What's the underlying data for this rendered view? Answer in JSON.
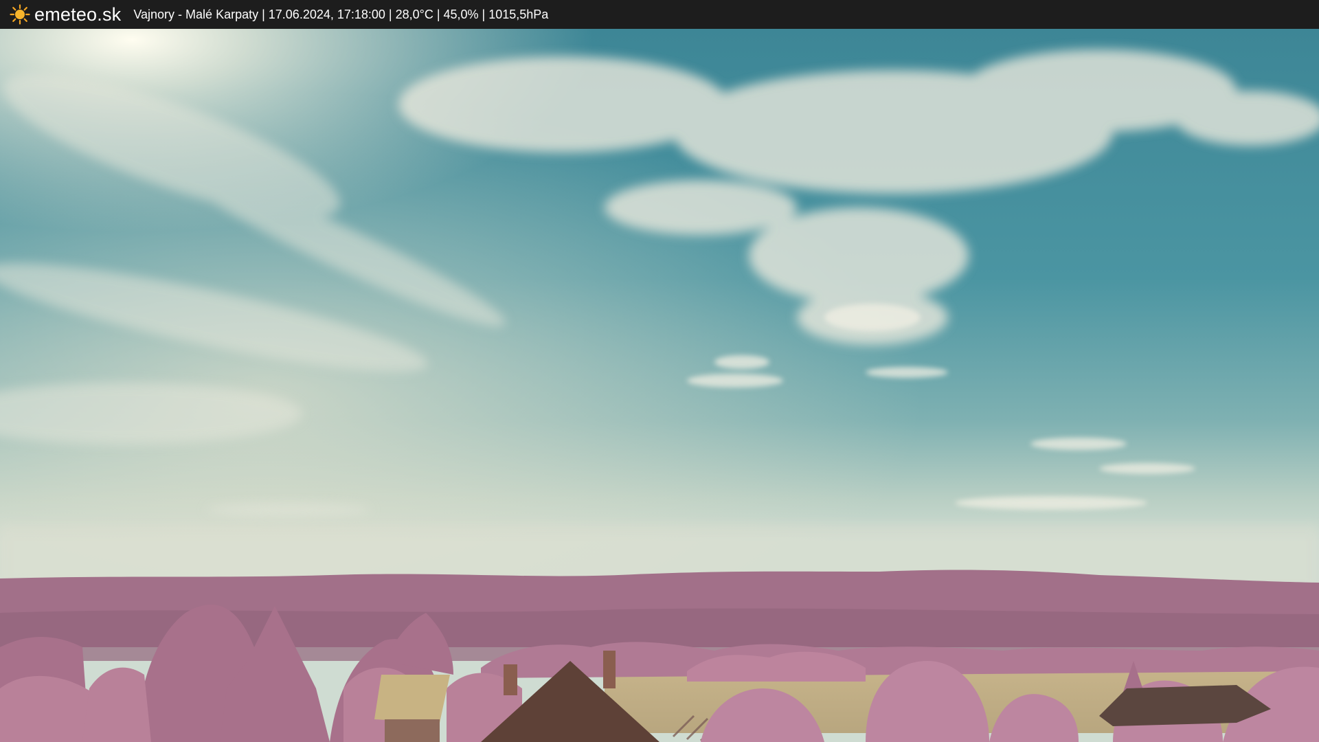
{
  "header": {
    "logo_text": "emeteo.sk",
    "logo_icon": "sun-icon",
    "caption": "Vajnory - Malé Karpaty | 17.06.2024, 17:18:00 | 28,0°C | 45,0% | 1015,5hPa"
  },
  "image": {
    "description_kind": "infrared webcam view",
    "colors": {
      "sky_top": "#3f8a98",
      "sky_bottom": "#c9d8cf",
      "foliage": "#b87f9a",
      "hills": "#9d6f87",
      "field": "#d2bf95",
      "roof": "#6a4a3e"
    }
  }
}
